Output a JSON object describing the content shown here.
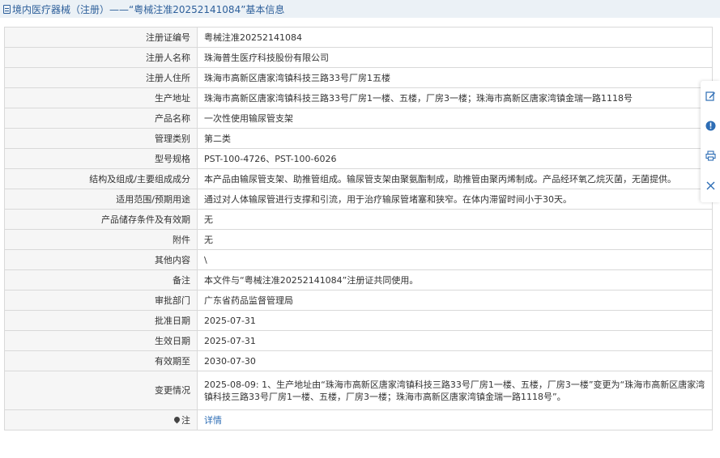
{
  "header": {
    "title": "境内医疗器械（注册）——“粤械注准20252141084”基本信息"
  },
  "rows": [
    {
      "label": "注册证编号",
      "value": "粤械注准20252141084"
    },
    {
      "label": "注册人名称",
      "value": "珠海普生医疗科技股份有限公司"
    },
    {
      "label": "注册人住所",
      "value": "珠海市高新区唐家湾镇科技三路33号厂房1五楼"
    },
    {
      "label": "生产地址",
      "value": "珠海市高新区唐家湾镇科技三路33号厂房1一楼、五楼，厂房3一楼；珠海市高新区唐家湾镇金瑞一路1118号"
    },
    {
      "label": "产品名称",
      "value": "一次性使用输尿管支架"
    },
    {
      "label": "管理类别",
      "value": "第二类"
    },
    {
      "label": "型号规格",
      "value": "PST-100-4726、PST-100-6026"
    },
    {
      "label": "结构及组成/主要组成成分",
      "value": "本产品由输尿管支架、助推管组成。输尿管支架由聚氨酯制成，助推管由聚丙烯制成。产品经环氧乙烷灭菌，无菌提供。"
    },
    {
      "label": "适用范围/预期用途",
      "value": "通过对人体输尿管进行支撑和引流，用于治疗输尿管堵塞和狭窄。在体内滞留时间小于30天。"
    },
    {
      "label": "产品储存条件及有效期",
      "value": "无"
    },
    {
      "label": "附件",
      "value": "无"
    },
    {
      "label": "其他内容",
      "value": "\\"
    },
    {
      "label": "备注",
      "value": "本文件与“粤械注准20252141084”注册证共同使用。"
    },
    {
      "label": "审批部门",
      "value": "广东省药品监督管理局"
    },
    {
      "label": "批准日期",
      "value": "2025-07-31"
    },
    {
      "label": "生效日期",
      "value": "2025-07-31"
    },
    {
      "label": "有效期至",
      "value": "2030-07-30"
    },
    {
      "label": "变更情况",
      "value": "2025-08-09: 1、生产地址由“珠海市高新区唐家湾镇科技三路33号厂房1一楼、五楼，厂房3一楼”变更为“珠海市高新区唐家湾镇科技三路33号厂房1一楼、五楼，厂房3一楼；珠海市高新区唐家湾镇金瑞一路1118号”。"
    }
  ],
  "note": {
    "label": "注",
    "link": "详情",
    "icon": "pin-icon"
  },
  "toolbar": {
    "icons": [
      "edit-icon",
      "info-icon",
      "print-icon",
      "close-icon"
    ],
    "accent": "#2d6db5"
  }
}
